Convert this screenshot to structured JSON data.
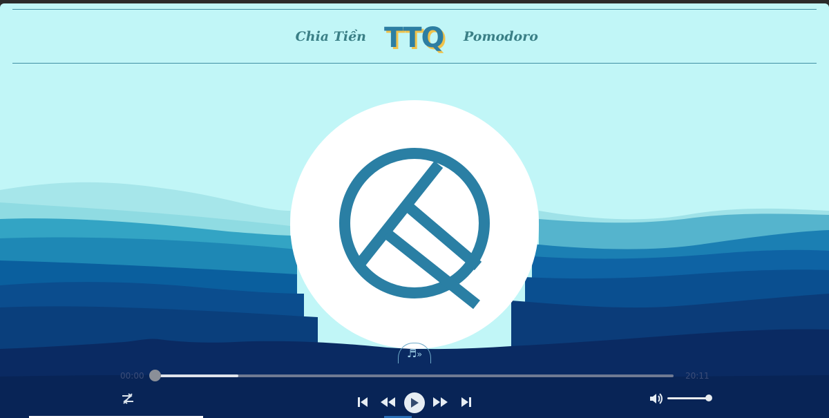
{
  "header": {
    "left_link": "Chia Tiền",
    "logo_text": "TTQ",
    "right_link": "Pomodoro"
  },
  "player": {
    "current_time": "00:00",
    "duration": "20:11",
    "progress": 0,
    "buffered": 0.16,
    "volume": 1.0
  },
  "icons": {
    "toggle": "music-note-double-chevron-down",
    "left_control": "shuffle-icon",
    "transport": [
      "skip-previous-icon",
      "rewind-icon",
      "play-icon",
      "fast-forward-icon",
      "skip-next-icon"
    ],
    "volume": "volume-icon"
  },
  "colors": {
    "sky": "#c1f6f7",
    "accent": "#2d7ea2",
    "logo_shadow": "#f0c24b",
    "link": "#3a7f86"
  }
}
